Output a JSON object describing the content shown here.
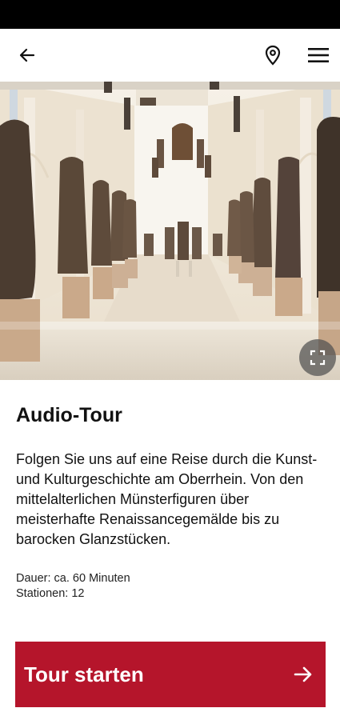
{
  "app_bar": {
    "icons": [
      "arrow-back-icon",
      "location-pin-icon",
      "hamburger-menu-icon"
    ]
  },
  "hero": {
    "fullscreen_icon": "fullscreen-icon"
  },
  "content": {
    "title": "Audio-Tour",
    "description": "Folgen Sie uns auf eine Reise durch die Kunst- und Kulturgeschichte am Oberrhein. Von den mittelalterlichen Münsterfiguren über meisterhafte Renaissancegemälde bis zu barocken Glanzstücken.",
    "duration": "Dauer: ca. 60 Minuten",
    "stations": "Stationen: 12"
  },
  "cta": {
    "label": "Tour starten",
    "icon": "arrow-forward-icon"
  },
  "colors": {
    "accent": "#b5152b",
    "status_bar": "#000000"
  }
}
